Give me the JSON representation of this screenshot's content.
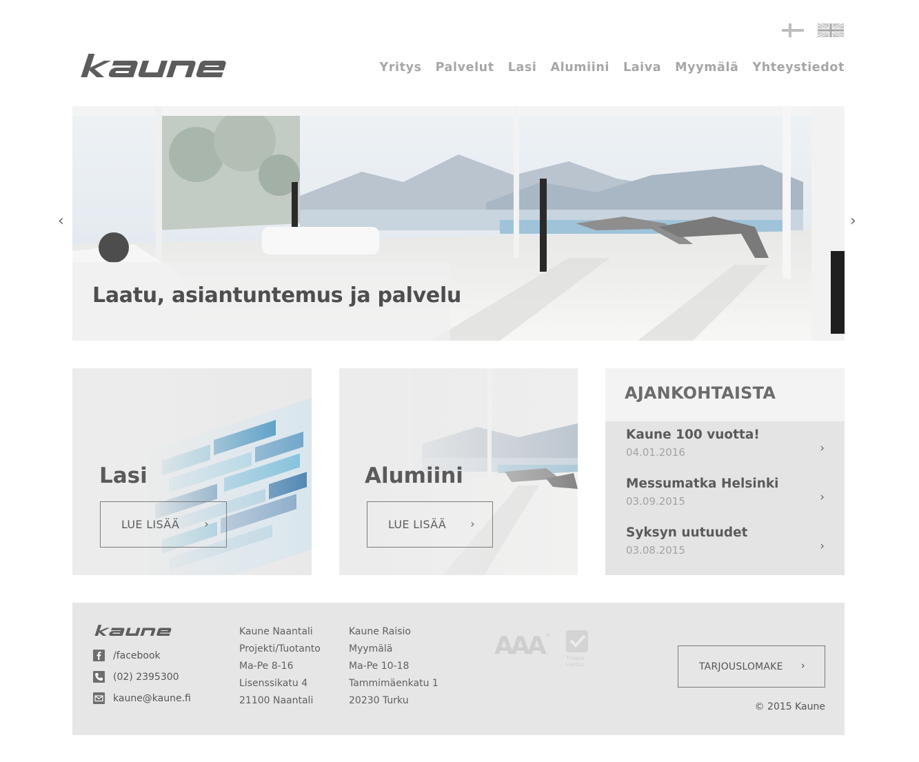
{
  "brand": {
    "name": "kaune"
  },
  "languages": [
    {
      "icon": "finland-flag-icon"
    },
    {
      "icon": "uk-flag-icon"
    }
  ],
  "nav": {
    "items": [
      "Yritys",
      "Palvelut",
      "Lasi",
      "Alumiini",
      "Laiva",
      "Myymälä",
      "Yhteystiedot"
    ]
  },
  "hero": {
    "caption": "Laatu, asiantuntemus ja palvelu",
    "prev_icon": "‹",
    "next_icon": "›"
  },
  "cards": [
    {
      "title": "Lasi",
      "button": "LUE LISÄÄ",
      "chevron": "›"
    },
    {
      "title": "Alumiini",
      "button": "LUE LISÄÄ",
      "chevron": "›"
    }
  ],
  "news": {
    "heading": "AJANKOHTAISTA",
    "items": [
      {
        "title": "Kaune 100 vuotta!",
        "date": "04.01.2016",
        "chevron": "›"
      },
      {
        "title": "Messumatka Helsinki",
        "date": "03.09.2015",
        "chevron": "›"
      },
      {
        "title": "Syksyn uutuudet",
        "date": "03.08.2015",
        "chevron": "›"
      }
    ]
  },
  "footer": {
    "contacts": [
      {
        "icon": "facebook-icon",
        "text": "/facebook"
      },
      {
        "icon": "phone-icon",
        "text": "(02) 2395300"
      },
      {
        "icon": "email-icon",
        "text": "kaune@kaune.fi"
      }
    ],
    "address1": [
      "Kaune Naantali",
      "Projekti/Tuotanto",
      "Ma-Pe 8-16",
      "Lisenssikatu 4",
      "21100 Naantali"
    ],
    "address2": [
      "Kaune Raisio",
      "Myymälä",
      "Ma-Pe 10-18",
      "Tammimäenkatu 1",
      "20230 Turku"
    ],
    "certificates": {
      "aaa": "AAA",
      "check_caption_1": "Tilaaja",
      "check_caption_2": "vastuu"
    },
    "offer_button": "TARJOUSLOMAKE",
    "offer_chevron": "›",
    "copyright": "© 2015 Kaune"
  },
  "colors": {
    "nav_text": "#a6a6a6",
    "heading_text": "#4e4e4e",
    "panel_bg": "#e6e6e6"
  }
}
